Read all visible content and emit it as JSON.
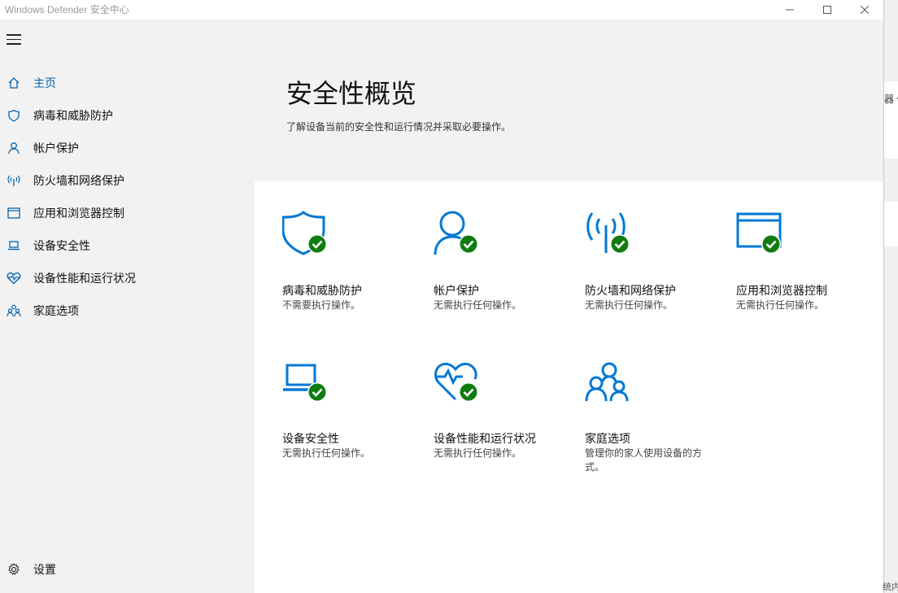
{
  "window": {
    "title": "Windows Defender 安全中心"
  },
  "sidebar": {
    "items": [
      {
        "label": "主页",
        "icon": "home-icon"
      },
      {
        "label": "病毒和威胁防护",
        "icon": "shield-icon"
      },
      {
        "label": "帐户保护",
        "icon": "person-icon"
      },
      {
        "label": "防火墙和网络保护",
        "icon": "wireless-icon"
      },
      {
        "label": "应用和浏览器控制",
        "icon": "browser-window-icon"
      },
      {
        "label": "设备安全性",
        "icon": "laptop-icon"
      },
      {
        "label": "设备性能和运行状况",
        "icon": "heart-pulse-icon"
      },
      {
        "label": "家庭选项",
        "icon": "family-icon"
      }
    ],
    "settings_label": "设置"
  },
  "main": {
    "title": "安全性概览",
    "subtitle": "了解设备当前的安全性和运行情况并采取必要操作。",
    "cards": [
      {
        "title": "病毒和威胁防护",
        "status": "不需要执行操作。",
        "icon": "shield-check-icon"
      },
      {
        "title": "帐户保护",
        "status": "无需执行任何操作。",
        "icon": "person-check-icon"
      },
      {
        "title": "防火墙和网络保护",
        "status": "无需执行任何操作。",
        "icon": "wireless-check-icon"
      },
      {
        "title": "应用和浏览器控制",
        "status": "无需执行任何操作。",
        "icon": "browser-check-icon"
      },
      {
        "title": "设备安全性",
        "status": "无需执行任何操作。",
        "icon": "laptop-check-icon"
      },
      {
        "title": "设备性能和运行状况",
        "status": "无需执行任何操作。",
        "icon": "heart-check-icon"
      },
      {
        "title": "家庭选项",
        "status": "管理你的家人使用设备的方式。",
        "icon": "family-icon"
      }
    ]
  },
  "background_app": {
    "text1": "器 ^",
    "text2": "统内"
  },
  "colors": {
    "accent": "#0063b1",
    "check_green": "#107c10",
    "sidebar_bg": "#f2f2f2",
    "content_bg": "#ffffff"
  }
}
